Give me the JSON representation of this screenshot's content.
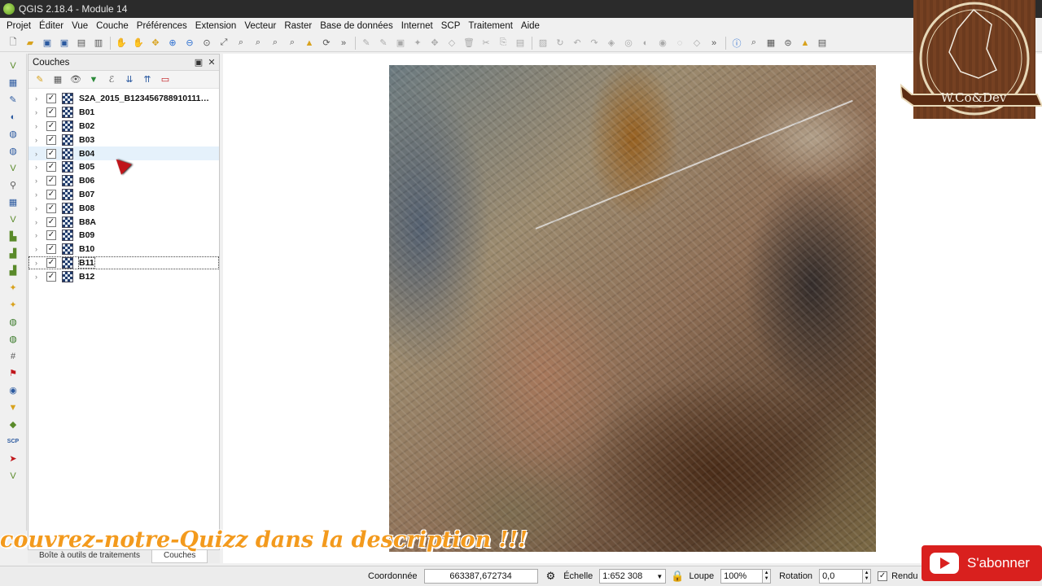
{
  "window": {
    "title": "QGIS 2.18.4 - Module 14"
  },
  "menu": [
    "Projet",
    "Éditer",
    "Vue",
    "Couche",
    "Préférences",
    "Extension",
    "Vecteur",
    "Raster",
    "Base de données",
    "Internet",
    "SCP",
    "Traitement",
    "Aide"
  ],
  "layers_panel": {
    "title": "Couches",
    "layers": [
      {
        "name": "S2A_2015_B123456788910111…",
        "checked": true
      },
      {
        "name": "B01",
        "checked": true
      },
      {
        "name": "B02",
        "checked": true
      },
      {
        "name": "B03",
        "checked": true
      },
      {
        "name": "B04",
        "checked": true
      },
      {
        "name": "B05",
        "checked": true
      },
      {
        "name": "B06",
        "checked": true
      },
      {
        "name": "B07",
        "checked": true
      },
      {
        "name": "B08",
        "checked": true
      },
      {
        "name": "B8A",
        "checked": true
      },
      {
        "name": "B09",
        "checked": true
      },
      {
        "name": "B10",
        "checked": true
      },
      {
        "name": "B11",
        "checked": true
      },
      {
        "name": "B12",
        "checked": true
      }
    ],
    "hover_layer": "B04",
    "selected_layer": "B11"
  },
  "bottom_tabs": [
    "Boîte à outils de traitements",
    "Couches"
  ],
  "statusbar": {
    "coord_label": "Coordonnée",
    "coord_value": "663387,672734",
    "scale_label": "Échelle",
    "scale_value": "1:652 308",
    "magnifier_label": "Loupe",
    "magnifier_value": "100%",
    "rotation_label": "Rotation",
    "rotation_value": "0,0",
    "render_label": "Rendu",
    "render_checked": true
  },
  "overlay": {
    "quiz_text": "couvrez-notre-Quizz dans la description !!!",
    "subscribe_label": "S'abonner",
    "watermark_text": "W.Co&Dev"
  },
  "colors": {
    "titlebar": "#2b2b2b",
    "quiz_orange": "#f39a1d",
    "subscribe_red": "#d9201e",
    "hover_blue": "#e5f1fb"
  }
}
